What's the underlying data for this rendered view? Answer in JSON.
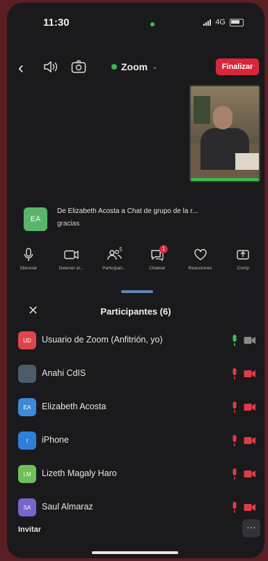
{
  "status_bar": {
    "time": "11:30",
    "network": "4G"
  },
  "header": {
    "title": "Zoom",
    "end_button": "Finalizar"
  },
  "chat_toast": {
    "initials": "EA",
    "line1": "De Elizabeth Acosta a Chat de grupo de la r...",
    "line2": "gracias"
  },
  "toolbar": [
    {
      "label": "Silenciar",
      "icon": "microphone-icon"
    },
    {
      "label": "Detener el...",
      "icon": "video-camera-icon"
    },
    {
      "label": "Participan...",
      "icon": "participants-icon",
      "count": "5"
    },
    {
      "label": "Chatear",
      "icon": "chat-icon",
      "badge": "1"
    },
    {
      "label": "Reacciones",
      "icon": "heart-icon"
    },
    {
      "label": "Comp",
      "icon": "share-icon"
    }
  ],
  "panel": {
    "title": "Participantes (6)",
    "participants": [
      {
        "initials": "UD",
        "name": "Usuario de Zoom (Anfitrión, yo)",
        "color": "#e0454e",
        "audio": "on"
      },
      {
        "initials": "",
        "name": "Anahi CdIS",
        "color": "#4b5d6b",
        "audio": "muted"
      },
      {
        "initials": "EA",
        "name": "Elizabeth Acosta",
        "color": "#3c8ad8",
        "audio": "muted"
      },
      {
        "initials": "I",
        "name": "iPhone",
        "color": "#2f7fd6",
        "audio": "muted"
      },
      {
        "initials": "LM",
        "name": "Lizeth Magaly Haro",
        "color": "#6fbf5a",
        "audio": "muted"
      },
      {
        "initials": "SA",
        "name": "Saul Almaraz",
        "color": "#7a63c9",
        "audio": "muted"
      }
    ],
    "invite_label": "Invitar",
    "more_label": "···"
  },
  "colors": {
    "end_button": "#d8273a",
    "muted": "#e03a48",
    "active": "#3bc24a"
  }
}
